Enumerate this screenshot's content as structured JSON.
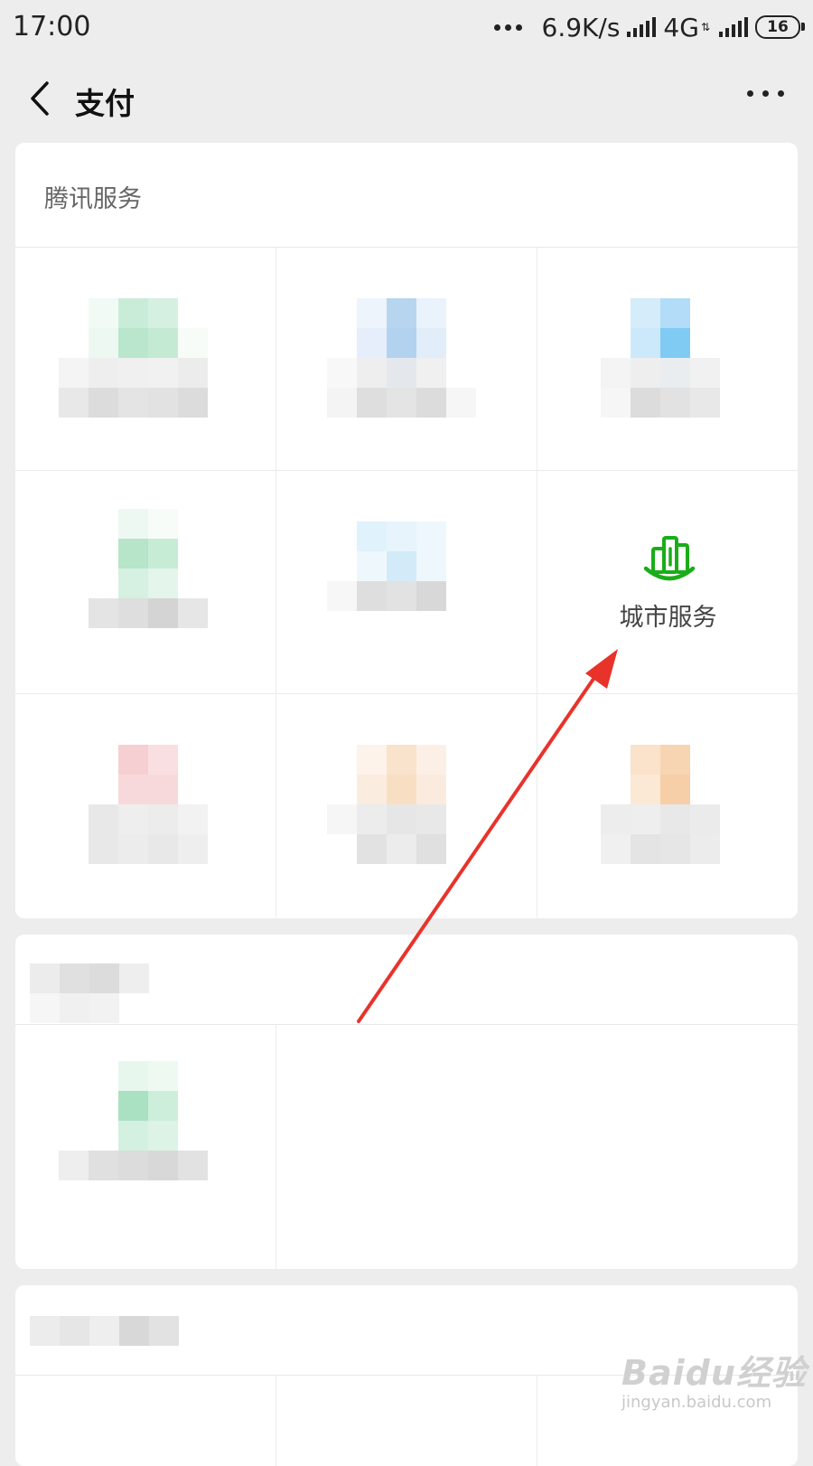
{
  "status": {
    "time": "17:00",
    "speed": "6.9K/s",
    "network": "4G",
    "battery": "16"
  },
  "nav": {
    "title": "支付"
  },
  "tencent_services": {
    "section_title": "腾讯服务",
    "city_service_label": "城市服务"
  },
  "colors": {
    "accent_green": "#1aad19",
    "arrow_red": "#e8332b"
  },
  "icons": [
    "back-icon",
    "more-icon",
    "city-service-icon"
  ],
  "watermark": {
    "main": "Baidu经验",
    "sub": "jingyan.baidu.com"
  }
}
